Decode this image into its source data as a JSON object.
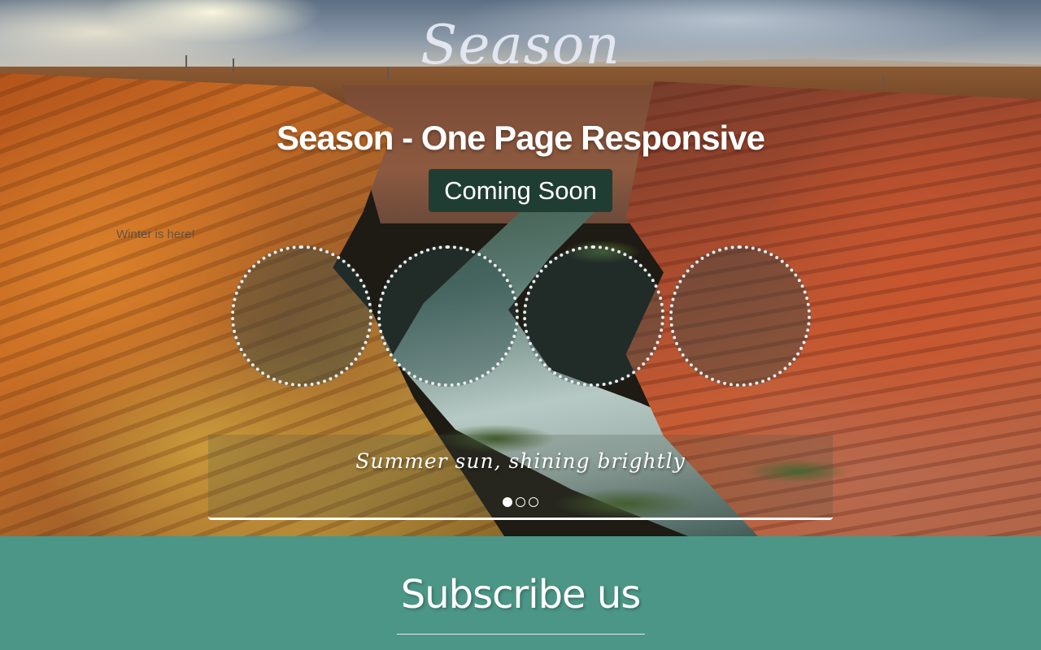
{
  "brand": {
    "logo_text": "Season"
  },
  "hero": {
    "headline": "Season - One Page Responsive",
    "badge": "Coming Soon",
    "winter_text": "Winter is here!",
    "countdown": [
      {
        "label": "countdown-circle-1"
      },
      {
        "label": "countdown-circle-2"
      },
      {
        "label": "countdown-circle-3"
      },
      {
        "label": "countdown-circle-4"
      }
    ]
  },
  "slider": {
    "caption": "Summer sun, shining brightly",
    "active_slide": 1,
    "slide_count": 3
  },
  "subscribe": {
    "title": "Subscribe us"
  },
  "colors": {
    "badge_bg": "#1f3d33",
    "subscribe_bg": "#4b9686",
    "circle_border": "#ececec"
  }
}
